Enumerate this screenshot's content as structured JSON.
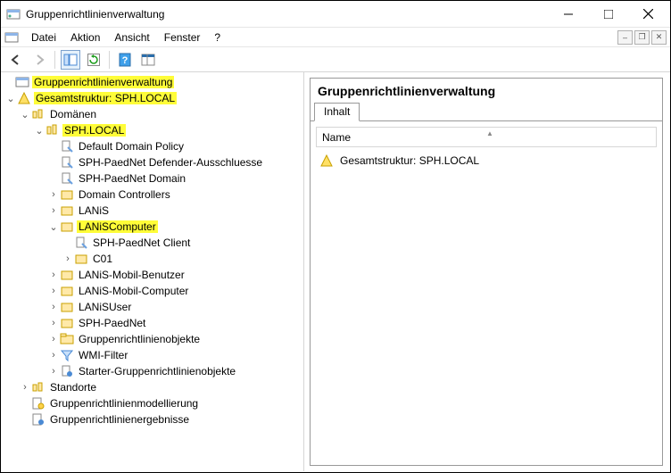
{
  "window": {
    "title": "Gruppenrichtlinienverwaltung"
  },
  "menus": {
    "file": "Datei",
    "action": "Aktion",
    "view": "Ansicht",
    "window": "Fenster",
    "help": "?"
  },
  "tree": {
    "root": "Gruppenrichtlinienverwaltung",
    "forest": "Gesamtstruktur: SPH.LOCAL",
    "domains": "Domänen",
    "domain": "SPH.LOCAL",
    "gpo_ddp": "Default Domain Policy",
    "gpo_defender": "SPH-PaedNet Defender-Ausschluesse",
    "gpo_paednet_domain": "SPH-PaedNet Domain",
    "ou_dc": "Domain Controllers",
    "ou_lanis": "LANiS",
    "ou_laniscomputer": "LANiSComputer",
    "gpo_paednet_client": "SPH-PaedNet Client",
    "ou_c01": "C01",
    "ou_mobilben": "LANiS-Mobil-Benutzer",
    "ou_mobilcom": "LANiS-Mobil-Computer",
    "ou_lanisuser": "LANiSUser",
    "ou_sphpaednet": "SPH-PaedNet",
    "node_gpo_container": "Gruppenrichtlinienobjekte",
    "node_wmi": "WMI-Filter",
    "node_starter": "Starter-Gruppenrichtlinienobjekte",
    "node_sites": "Standorte",
    "node_modeling": "Gruppenrichtlinienmodellierung",
    "node_results": "Gruppenrichtlinienergebnisse"
  },
  "detail": {
    "heading": "Gruppenrichtlinienverwaltung",
    "tab": "Inhalt",
    "col_name": "Name",
    "row1": "Gesamtstruktur: SPH.LOCAL"
  }
}
